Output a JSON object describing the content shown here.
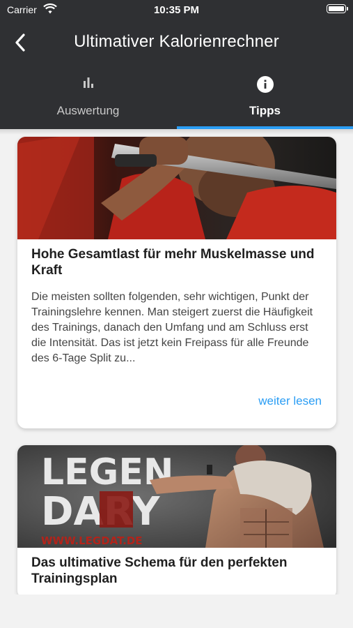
{
  "status_bar": {
    "carrier": "Carrier",
    "time": "10:35 PM"
  },
  "app_bar": {
    "title": "Ultimativer Kalorienrechner"
  },
  "tabs": [
    {
      "label": "Auswertung",
      "icon": "bar-chart-icon",
      "selected": false
    },
    {
      "label": "Tipps",
      "icon": "info-icon",
      "selected": true
    }
  ],
  "articles": [
    {
      "title": "Hohe Gesamtlast für mehr Muskelmasse und Kraft",
      "excerpt": "Die meisten sollten folgenden, sehr wichtigen, Punkt der Trainingslehre kennen. Man steigert zuerst die Häufigkeit des Trainings, danach den Umfang und am Schluss erst die Intensität. Das ist jetzt kein Freipass für alle Freunde des 6-Tage Split zu...",
      "read_more": "weiter lesen"
    },
    {
      "title": "Das ultimative Schema für den perfekten Trainingsplan",
      "image_text_1": "LEGEN",
      "image_text_2": "DARY",
      "image_url_text": "WWW.LEGDAT.DE"
    }
  ],
  "colors": {
    "header": "#2f3033",
    "accent": "#2a9df4",
    "background": "#f2f2f2"
  }
}
